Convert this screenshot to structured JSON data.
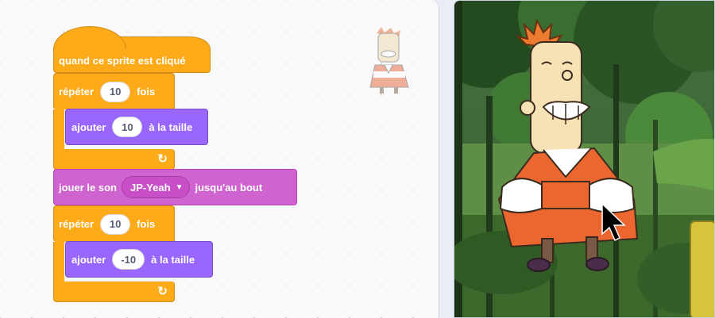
{
  "script": {
    "hat": {
      "label": "quand ce sprite est cliqué"
    },
    "repeat1": {
      "label": "répéter",
      "count": "10",
      "suffix": "fois"
    },
    "change1": {
      "label": "ajouter",
      "value": "10",
      "suffix": "à la taille"
    },
    "sound": {
      "label": "jouer le son",
      "sound_name": "JP-Yeah",
      "suffix": "jusqu'au bout"
    },
    "repeat2": {
      "label": "répéter",
      "count": "10",
      "suffix": "fois"
    },
    "change2": {
      "label": "ajouter",
      "value": "-10",
      "suffix": "à la taille"
    }
  },
  "icons": {
    "loop": "↻",
    "dropdown": "▼"
  },
  "colors": {
    "control": "#ffab19",
    "looks": "#9966ff",
    "sound": "#cf63cf",
    "events": "#ffbf00"
  }
}
